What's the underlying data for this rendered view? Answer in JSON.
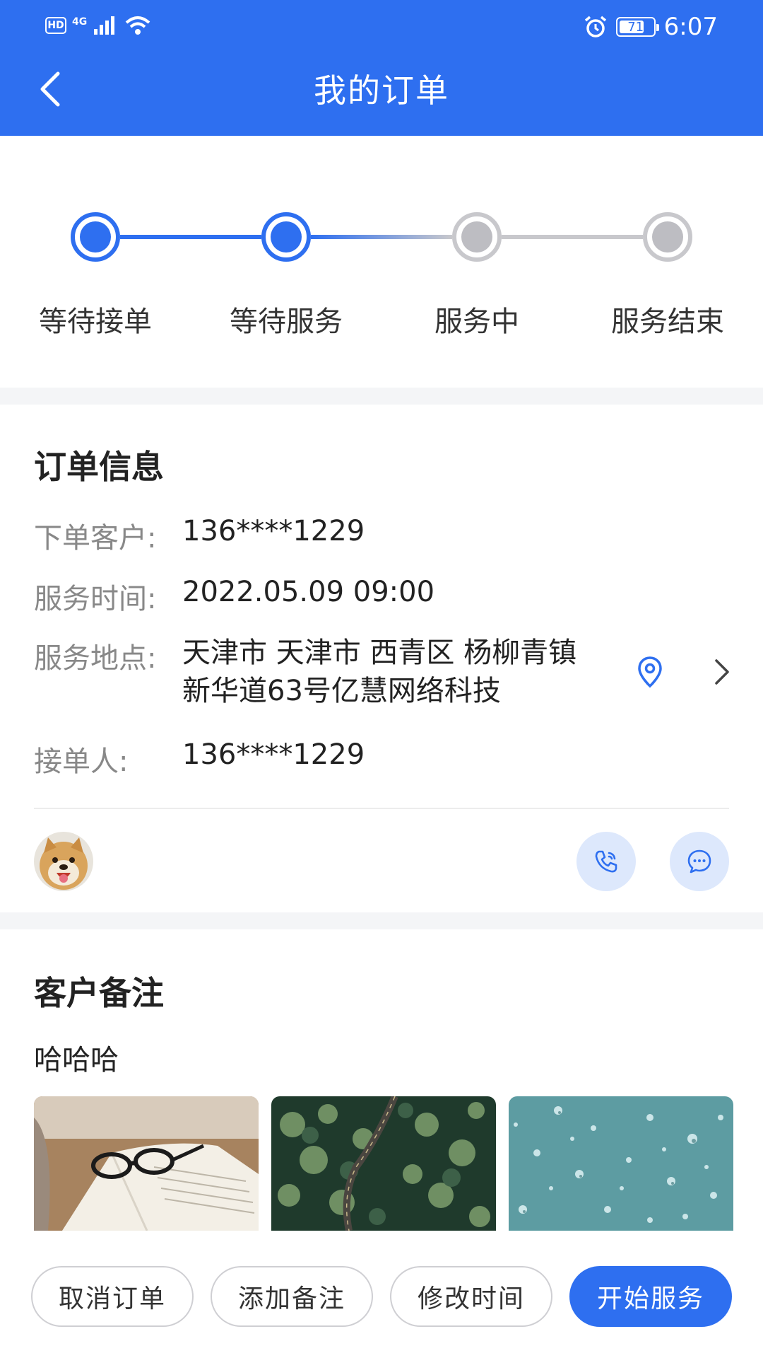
{
  "status_bar": {
    "hd": "HD",
    "network": "4G",
    "battery": "71",
    "battery_level": 0.71,
    "time": "6:07"
  },
  "nav": {
    "title": "我的订单"
  },
  "steps": [
    {
      "label": "等待接单",
      "active": true
    },
    {
      "label": "等待服务",
      "active": true
    },
    {
      "label": "服务中",
      "active": false
    },
    {
      "label": "服务结束",
      "active": false
    }
  ],
  "order_info": {
    "title": "订单信息",
    "customer_label": "下单客户:",
    "customer_value": "136****1229",
    "time_label": "服务时间:",
    "time_value": "2022.05.09 09:00",
    "address_label": "服务地点:",
    "address_line1": "天津市 天津市 西青区 杨柳青镇",
    "address_line2": "新华道63号亿慧网络科技",
    "receiver_label": "接单人:",
    "receiver_value": "136****1229"
  },
  "notes": {
    "title": "客户备注",
    "text": "哈哈哈"
  },
  "actions": {
    "cancel": "取消订单",
    "add_note": "添加备注",
    "change_time": "修改时间",
    "start": "开始服务"
  },
  "colors": {
    "primary": "#2e6ff0",
    "inactive": "#bdbdc2"
  }
}
